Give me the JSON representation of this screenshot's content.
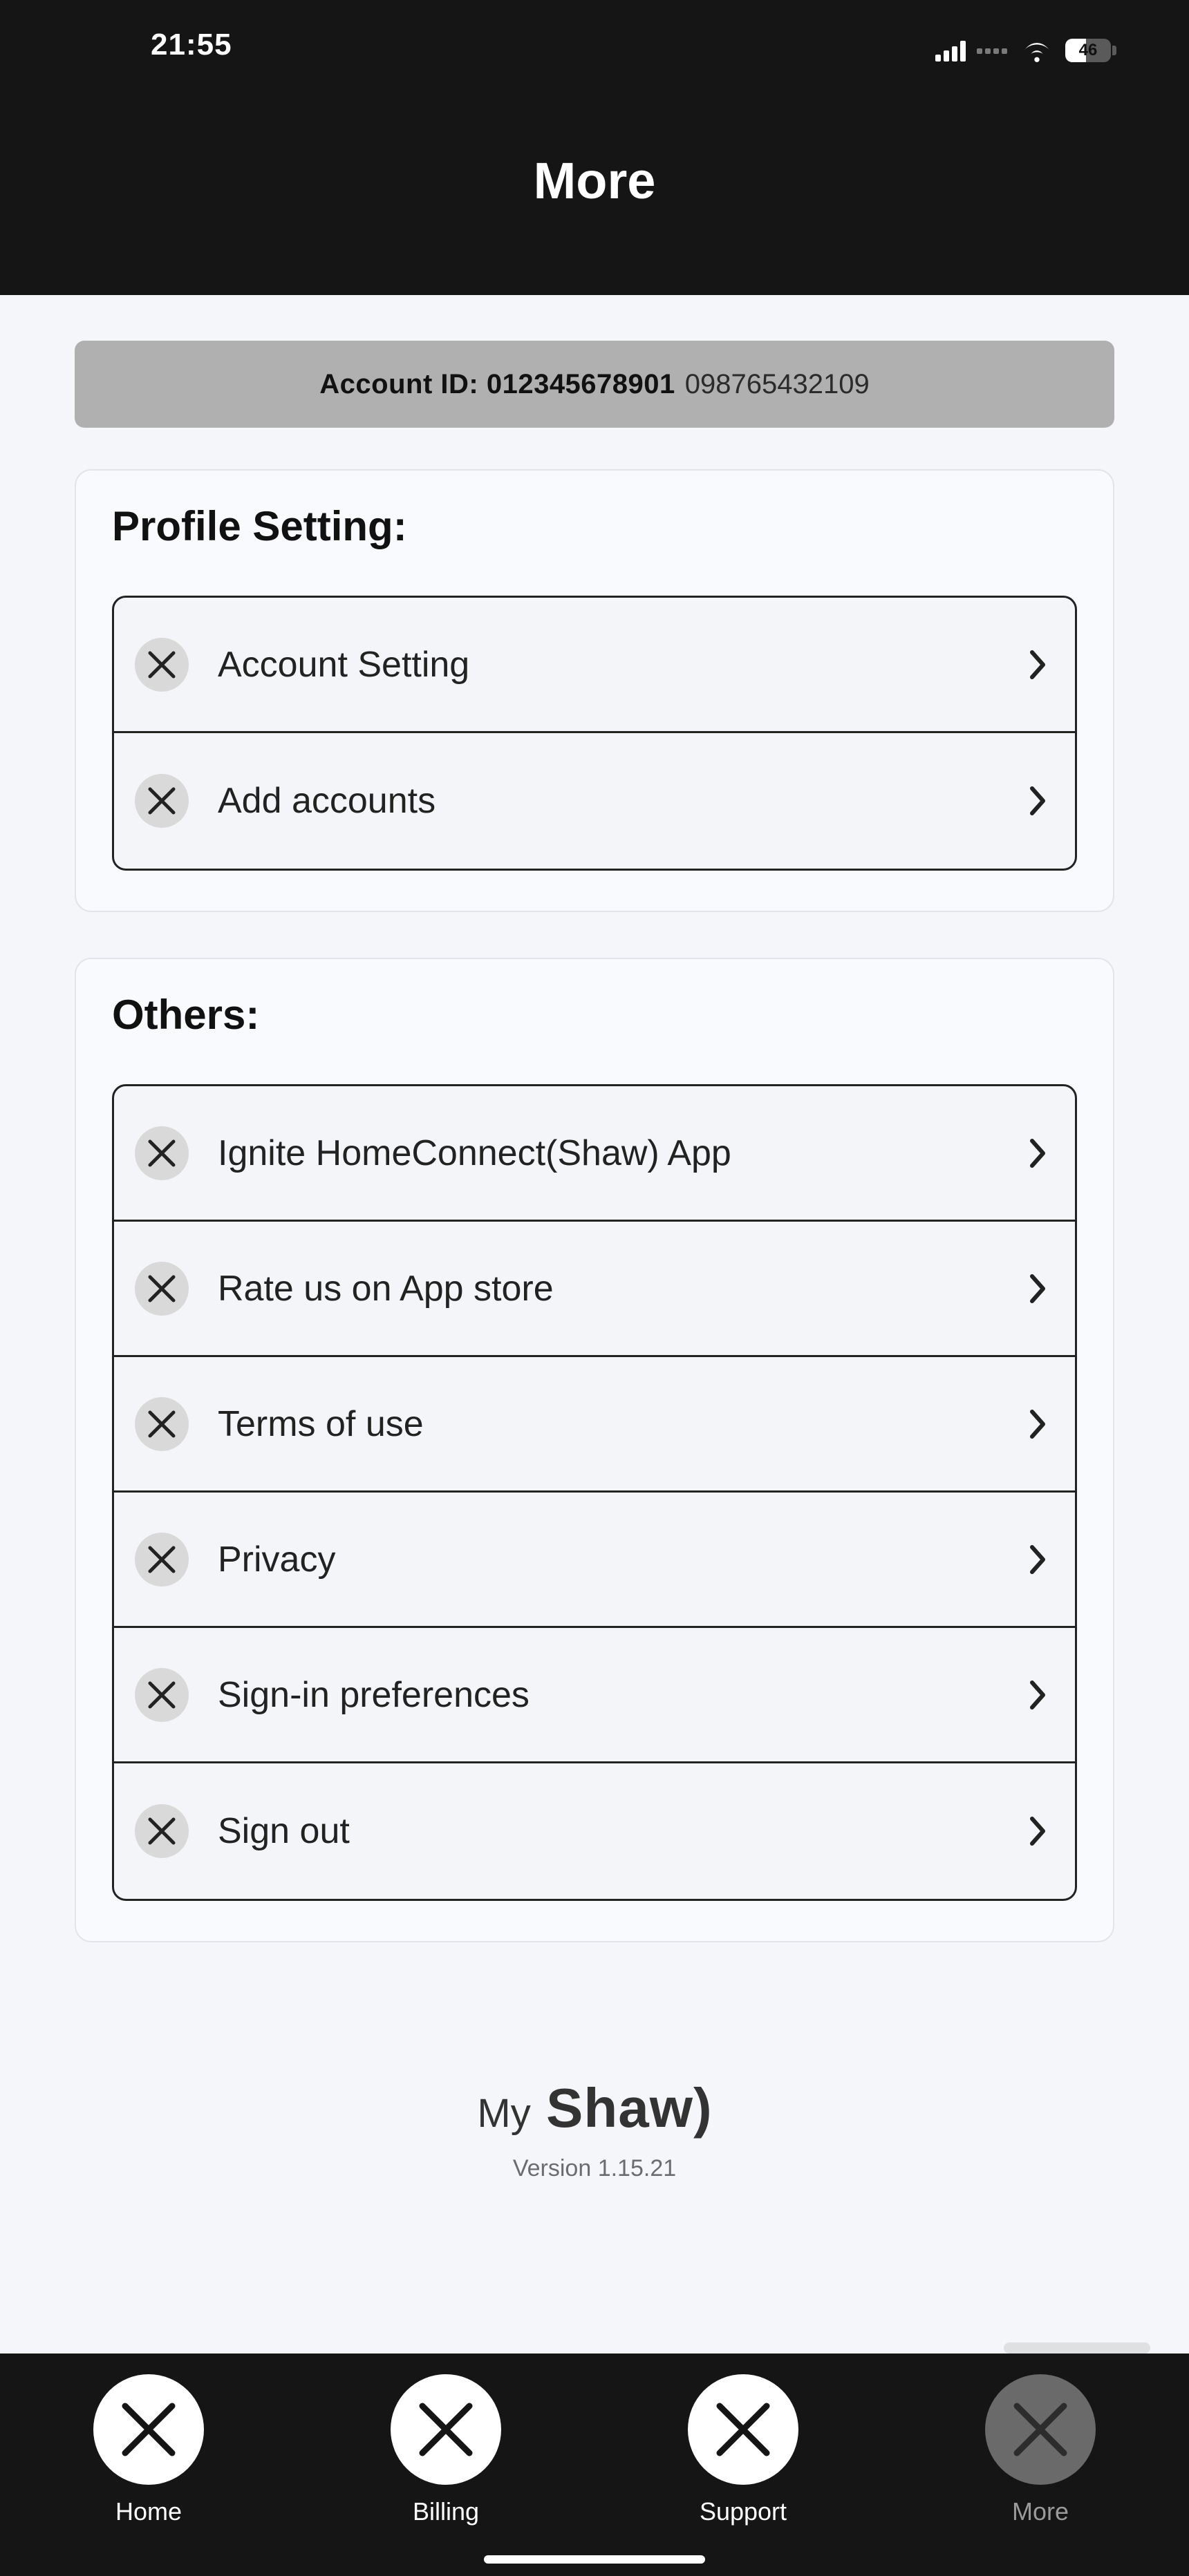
{
  "status": {
    "time": "21:55",
    "battery": "46"
  },
  "header": {
    "title": "More"
  },
  "account": {
    "label": "Account ID:",
    "primary": "012345678901",
    "secondary": "098765432109"
  },
  "sections": {
    "profile": {
      "title": "Profile Setting:",
      "items": [
        {
          "label": "Account Setting"
        },
        {
          "label": "Add accounts"
        }
      ]
    },
    "others": {
      "title": "Others:",
      "items": [
        {
          "label": "Ignite HomeConnect(Shaw) App"
        },
        {
          "label": "Rate us on App store"
        },
        {
          "label": "Terms of use"
        },
        {
          "label": "Privacy"
        },
        {
          "label": "Sign-in preferences"
        },
        {
          "label": "Sign out"
        }
      ]
    }
  },
  "brand": {
    "my": "My",
    "name": "Shaw",
    "paren": ")"
  },
  "version": "Version 1.15.21",
  "tabs": [
    {
      "label": "Home"
    },
    {
      "label": "Billing"
    },
    {
      "label": "Support"
    },
    {
      "label": "More"
    }
  ]
}
